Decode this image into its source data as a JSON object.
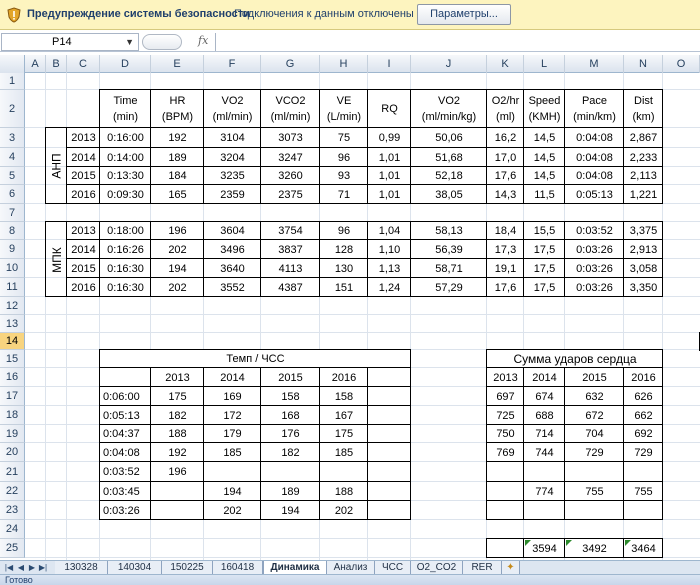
{
  "security_bar": {
    "title": "Предупреждение системы безопасности",
    "message": "Подключения к данным отключены",
    "button": "Параметры..."
  },
  "formula_bar": {
    "cell_ref": "P14",
    "fx": "fx",
    "value": ""
  },
  "columns": [
    "A",
    "B",
    "C",
    "D",
    "E",
    "F",
    "G",
    "H",
    "I",
    "J",
    "K",
    "L",
    "M",
    "N",
    "O"
  ],
  "rows": [
    "1",
    "2",
    "3",
    "4",
    "5",
    "6",
    "7",
    "8",
    "9",
    "10",
    "11",
    "12",
    "13",
    "14",
    "15",
    "16",
    "17",
    "18",
    "19",
    "20",
    "21",
    "22",
    "23",
    "24",
    "25"
  ],
  "selected_row": "14",
  "table1": {
    "headers": [
      [
        "Time",
        "(min)"
      ],
      [
        "HR",
        "(BPM)"
      ],
      [
        "VO2",
        "(ml/min)"
      ],
      [
        "VCO2",
        "(ml/min)"
      ],
      [
        "VE",
        "(L/min)"
      ],
      [
        "RQ",
        ""
      ],
      [
        "VO2",
        "(ml/min/kg)"
      ],
      [
        "O2/hr",
        "(ml)"
      ],
      [
        "Speed",
        "(KMH)"
      ],
      [
        "Pace",
        "(min/km)"
      ],
      [
        "Dist",
        "(km)"
      ]
    ],
    "groups": [
      {
        "label": "АНП",
        "rows": [
          [
            "2013",
            "0:16:00",
            "192",
            "3104",
            "3073",
            "75",
            "0,99",
            "50,06",
            "16,2",
            "14,5",
            "0:04:08",
            "2,867"
          ],
          [
            "2014",
            "0:14:00",
            "189",
            "3204",
            "3247",
            "96",
            "1,01",
            "51,68",
            "17,0",
            "14,5",
            "0:04:08",
            "2,233"
          ],
          [
            "2015",
            "0:13:30",
            "184",
            "3235",
            "3260",
            "93",
            "1,01",
            "52,18",
            "17,6",
            "14,5",
            "0:04:08",
            "2,113"
          ],
          [
            "2016",
            "0:09:30",
            "165",
            "2359",
            "2375",
            "71",
            "1,01",
            "38,05",
            "14,3",
            "11,5",
            "0:05:13",
            "1,221"
          ]
        ]
      },
      {
        "label": "МПК",
        "rows": [
          [
            "2013",
            "0:18:00",
            "196",
            "3604",
            "3754",
            "96",
            "1,04",
            "58,13",
            "18,4",
            "15,5",
            "0:03:52",
            "3,375"
          ],
          [
            "2014",
            "0:16:26",
            "202",
            "3496",
            "3837",
            "128",
            "1,10",
            "56,39",
            "17,3",
            "17,5",
            "0:03:26",
            "2,913"
          ],
          [
            "2015",
            "0:16:30",
            "194",
            "3640",
            "4113",
            "130",
            "1,13",
            "58,71",
            "19,1",
            "17,5",
            "0:03:26",
            "3,058"
          ],
          [
            "2016",
            "0:16:30",
            "202",
            "3552",
            "4387",
            "151",
            "1,24",
            "57,29",
            "17,6",
            "17,5",
            "0:03:26",
            "3,350"
          ]
        ]
      }
    ]
  },
  "table2": {
    "title": "Темп / ЧСС",
    "years": [
      "2013",
      "2014",
      "2015",
      "2016"
    ],
    "rows": [
      [
        "0:06:00",
        "175",
        "169",
        "158",
        "158"
      ],
      [
        "0:05:13",
        "182",
        "172",
        "168",
        "167"
      ],
      [
        "0:04:37",
        "188",
        "179",
        "176",
        "175"
      ],
      [
        "0:04:08",
        "192",
        "185",
        "182",
        "185"
      ],
      [
        "0:03:52",
        "196",
        "",
        "",
        ""
      ],
      [
        "0:03:45",
        "",
        "194",
        "189",
        "188"
      ],
      [
        "0:03:26",
        "",
        "202",
        "194",
        "202"
      ]
    ]
  },
  "table3": {
    "title": "Сумма ударов сердца",
    "years": [
      "2013",
      "2014",
      "2015",
      "2016"
    ],
    "rows": [
      [
        "697",
        "674",
        "632",
        "626"
      ],
      [
        "725",
        "688",
        "672",
        "662"
      ],
      [
        "750",
        "714",
        "704",
        "692"
      ],
      [
        "769",
        "744",
        "729",
        "729"
      ],
      [
        "",
        "",
        "",
        ""
      ],
      [
        "",
        "774",
        "755",
        "755"
      ],
      [
        "",
        "",
        "",
        ""
      ]
    ],
    "totals": [
      "",
      "3594",
      "3492",
      "3464"
    ]
  },
  "sheet_tabs": [
    "130328",
    "140304",
    "150225",
    "160418",
    "Динамика",
    "Анализ",
    "ЧСС",
    "O2_CO2",
    "RER"
  ],
  "active_tab": "Динамика",
  "status": "Готово",
  "colors": {
    "selected_row_header": "#f8d47f",
    "security_bar": "#fdf4bf"
  }
}
